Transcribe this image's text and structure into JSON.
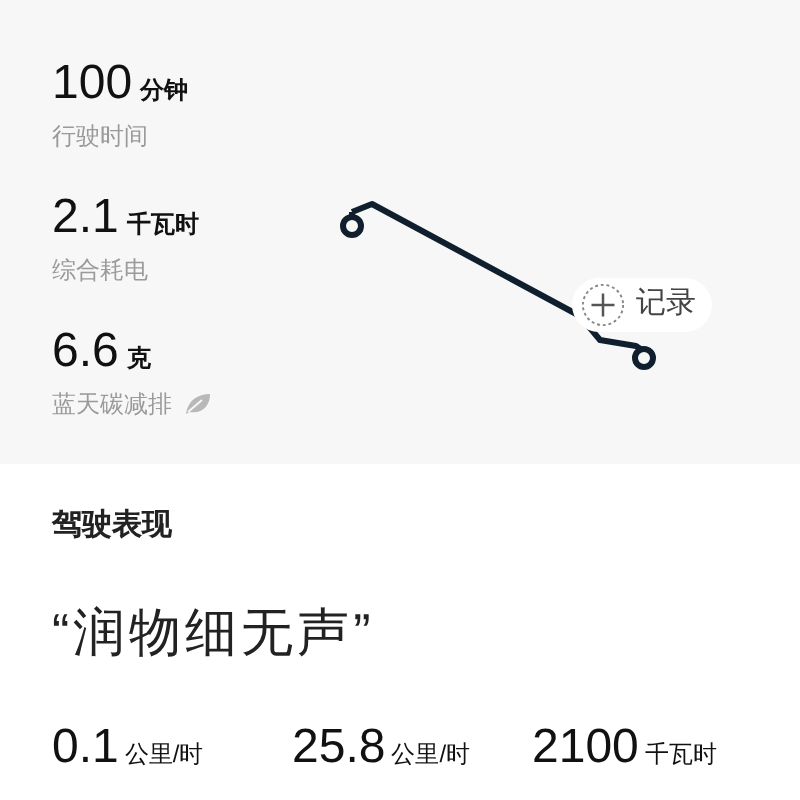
{
  "trip_stats": [
    {
      "value": "100",
      "unit": "分钟",
      "label": "行驶时间",
      "kind": "plain"
    },
    {
      "value": "2.1",
      "unit": "千瓦时",
      "label": "综合耗电",
      "kind": "plain"
    },
    {
      "value": "6.6",
      "unit": "克",
      "label": "蓝天碳减排",
      "kind": "leaf"
    }
  ],
  "record_button": {
    "label": "记录"
  },
  "driving_performance": {
    "title": "驾驶表现",
    "quote": "“润物细无声”",
    "metrics": [
      {
        "value": "0.1",
        "unit": "公里/时"
      },
      {
        "value": "25.8",
        "unit": "公里/时"
      },
      {
        "value": "2100",
        "unit": "千瓦时"
      }
    ]
  }
}
